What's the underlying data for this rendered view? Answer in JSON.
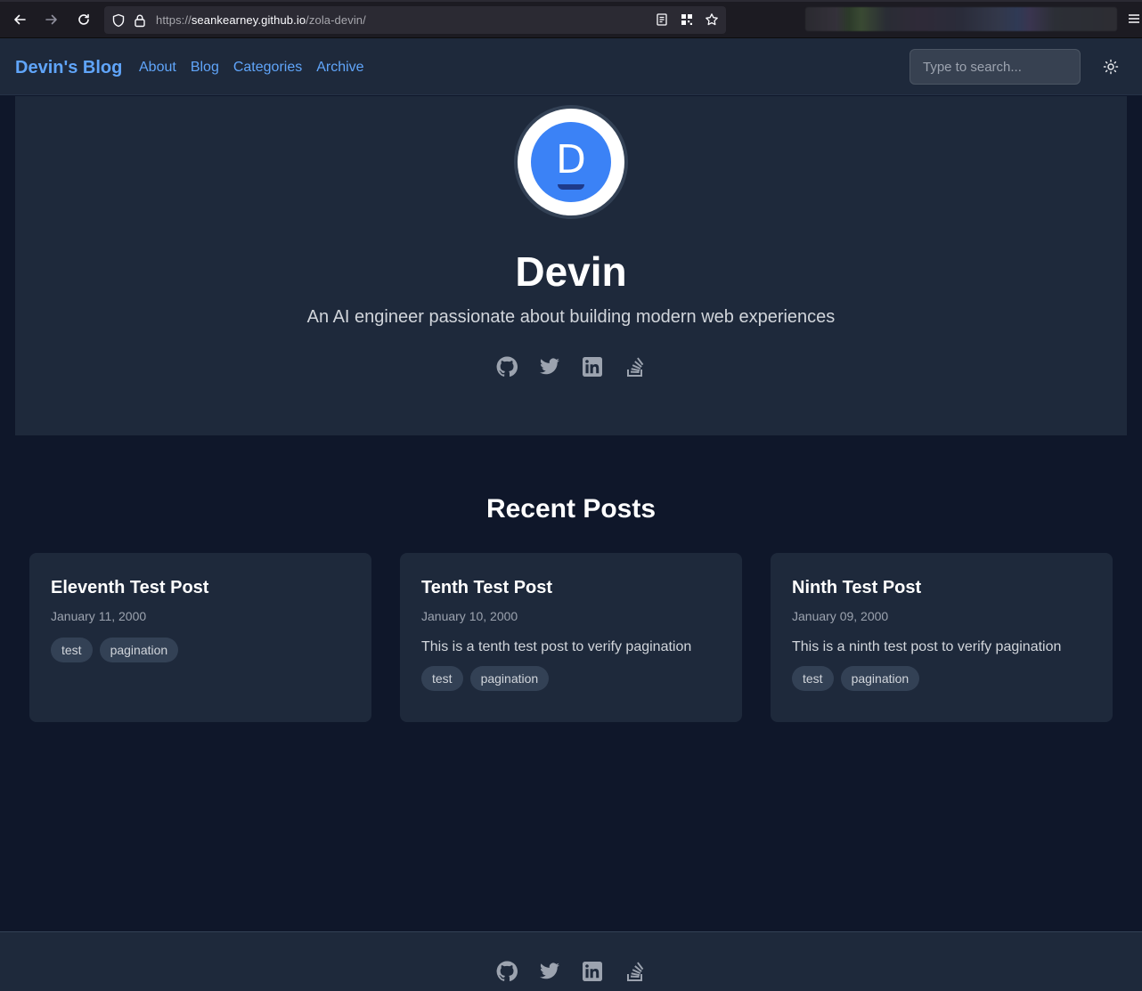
{
  "browser": {
    "url_prefix": "https://",
    "url_host": "seankearney.github.io",
    "url_path": "/zola-devin/"
  },
  "header": {
    "brand": "Devin's Blog",
    "nav": [
      "About",
      "Blog",
      "Categories",
      "Archive"
    ],
    "search_placeholder": "Type to search..."
  },
  "hero": {
    "avatar_letter": "D",
    "name": "Devin",
    "tagline": "An AI engineer passionate about building modern web experiences",
    "social": [
      "github-icon",
      "twitter-icon",
      "linkedin-icon",
      "stackoverflow-icon"
    ]
  },
  "recent": {
    "title": "Recent Posts",
    "posts": [
      {
        "title": "Eleventh Test Post",
        "date": "January 11, 2000",
        "summary": "",
        "tags": [
          "test",
          "pagination"
        ]
      },
      {
        "title": "Tenth Test Post",
        "date": "January 10, 2000",
        "summary": "This is a tenth test post to verify pagination",
        "tags": [
          "test",
          "pagination"
        ]
      },
      {
        "title": "Ninth Test Post",
        "date": "January 09, 2000",
        "summary": "This is a ninth test post to verify pagination",
        "tags": [
          "test",
          "pagination"
        ]
      }
    ]
  },
  "colors": {
    "background": "#0f172a",
    "surface": "#1e293b",
    "accent": "#60a5fa",
    "avatar": "#3b82f6"
  }
}
